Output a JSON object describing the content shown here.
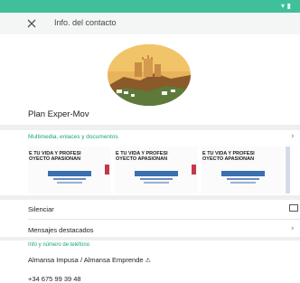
{
  "appbar": {
    "title": "Info. del contacto"
  },
  "contact": {
    "name": "Plan Exper-Mov",
    "photo_icon": "castle-photo"
  },
  "media": {
    "link_label": "Multimedia, enlaces y documentos",
    "thumbnails": [
      {
        "header_line1": "E TU VIDA Y PROFESI",
        "header_line2": "OYECTO APASIONAN"
      },
      {
        "header_line1": "E TU VIDA Y PROFESI",
        "header_line2": "OYECTO APASIONAN"
      },
      {
        "header_line1": "E TU VIDA Y PROFESI",
        "header_line2": "OYECTO APASIONAN"
      }
    ]
  },
  "settings": {
    "mute_label": "Silenciar",
    "starred_label": "Mensajes destacados"
  },
  "info": {
    "heading": "Info y número de teléfono",
    "status": "Almansa Impusa / Almansa Emprende",
    "phone": "+34 675 99 39 48"
  },
  "colors": {
    "accent": "#1aa37f",
    "statusbar": "#3fbf9a"
  }
}
